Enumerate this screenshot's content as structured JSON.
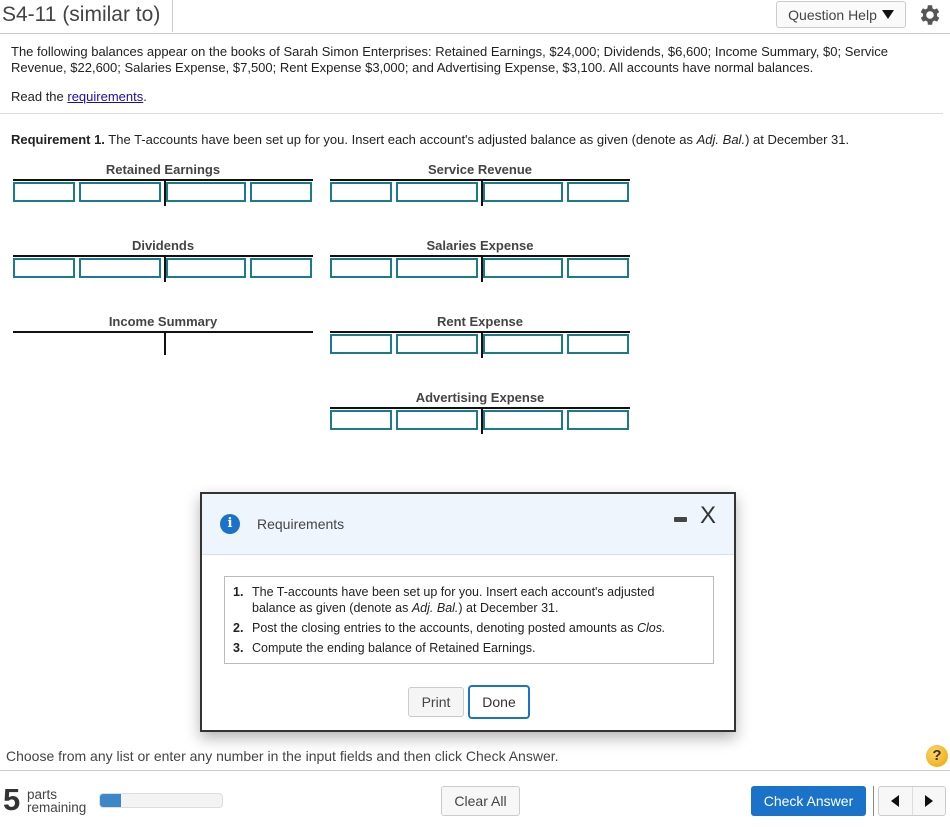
{
  "header": {
    "title": "S4-11 (similar to)",
    "question_help_label": "Question Help",
    "settings_icon": "gear-icon"
  },
  "problem": {
    "intro": "The following balances appear on the books of Sarah Simon Enterprises: Retained Earnings, $24,000; Dividends, $6,600; Income Summary, $0; Service Revenue, $22,600; Salaries Expense, $7,500; Rent Expense $3,000; and Advertising Expense, $3,100. All accounts have normal balances.",
    "read_prefix": "Read the ",
    "read_link": "requirements",
    "read_suffix": ".",
    "requirement_label": "Requirement 1.",
    "requirement_text": " The T-accounts have been set up for you. Insert each account's adjusted balance as given (denote as ",
    "requirement_italic": "Adj. Bal.",
    "requirement_end": ") at December 31."
  },
  "t_accounts": [
    {
      "name": "Retained Earnings",
      "has_inputs": true
    },
    {
      "name": "Service Revenue",
      "has_inputs": true
    },
    {
      "name": "Dividends",
      "has_inputs": true
    },
    {
      "name": "Salaries Expense",
      "has_inputs": true
    },
    {
      "name": "Income Summary",
      "has_inputs": false
    },
    {
      "name": "Rent Expense",
      "has_inputs": true
    },
    {
      "name": "Advertising Expense",
      "has_inputs": true
    }
  ],
  "dialog": {
    "title": "Requirements",
    "items": [
      {
        "num": "1.",
        "text": "The T-accounts have been set up for you. Insert each account's adjusted balance as given (denote as ",
        "italic": "Adj. Bal.",
        "end": ") at December 31."
      },
      {
        "num": "2.",
        "text": "Post the closing entries to the accounts, denoting posted amounts as ",
        "italic": "Clos.",
        "end": ""
      },
      {
        "num": "3.",
        "text": "Compute the ending balance of Retained Earnings.",
        "italic": "",
        "end": ""
      }
    ],
    "print_label": "Print",
    "done_label": "Done",
    "minimize_icon": "minimize-icon",
    "close_label": "X"
  },
  "footer": {
    "instruction": "Choose from any list or enter any number in the input fields and then click Check Answer.",
    "help_label": "?",
    "parts_count": "5",
    "parts_line1": "parts",
    "parts_line2": "remaining",
    "progress_fraction": 0.17,
    "clear_all_label": "Clear All",
    "check_answer_label": "Check Answer"
  },
  "colors": {
    "accent": "#1a73c8",
    "input_border": "#1b7a8c",
    "dialog_header_bg": "#eef5fc"
  }
}
